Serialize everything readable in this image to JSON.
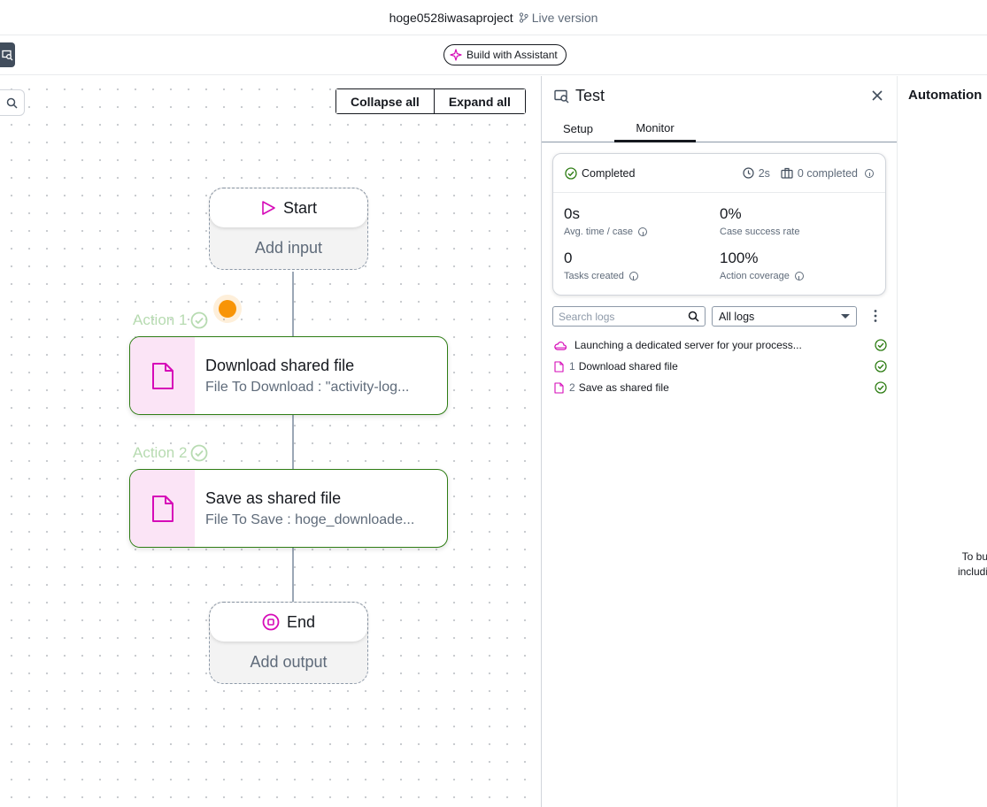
{
  "header": {
    "project_name": "hoge0528iwasaproject",
    "version_label": "Live version"
  },
  "toolbar": {
    "assistant_button": "Build with Assistant"
  },
  "canvas": {
    "collapse_all": "Collapse all",
    "expand_all": "Expand all",
    "start": {
      "label": "Start",
      "footer": "Add input"
    },
    "end": {
      "label": "End",
      "footer": "Add output"
    },
    "actions": [
      {
        "label": "Action 1",
        "title": "Download shared file",
        "subtitle": "File To Download : \"activity-log..."
      },
      {
        "label": "Action 2",
        "title": "Save as shared file",
        "subtitle": "File To Save : hoge_downloade..."
      }
    ]
  },
  "test_panel": {
    "title": "Test",
    "tabs": [
      {
        "label": "Setup"
      },
      {
        "label": "Monitor",
        "active": true
      }
    ],
    "summary": {
      "status": "Completed",
      "duration": "2s",
      "completed_count": "0 completed",
      "metrics": [
        {
          "value": "0s",
          "label": "Avg. time / case"
        },
        {
          "value": "0%",
          "label": "Case success rate"
        },
        {
          "value": "0",
          "label": "Tasks created"
        },
        {
          "value": "100%",
          "label": "Action coverage"
        }
      ]
    },
    "search_placeholder": "Search logs",
    "filter_value": "All logs",
    "logs": [
      {
        "num": "",
        "text": "Launching a dedicated server for your process...",
        "icon": "cloud-icon"
      },
      {
        "num": "1",
        "text": "Download shared file",
        "icon": "file-icon"
      },
      {
        "num": "2",
        "text": "Save as shared file",
        "icon": "file-icon"
      }
    ]
  },
  "right_panel": {
    "title": "Automation",
    "text_line1": "To bu",
    "text_line2": "includi"
  },
  "colors": {
    "accent_magenta": "#d60bb8",
    "success_green": "#2e7d14",
    "action_border": "#2e7d14",
    "orange_dot": "#f89406"
  }
}
